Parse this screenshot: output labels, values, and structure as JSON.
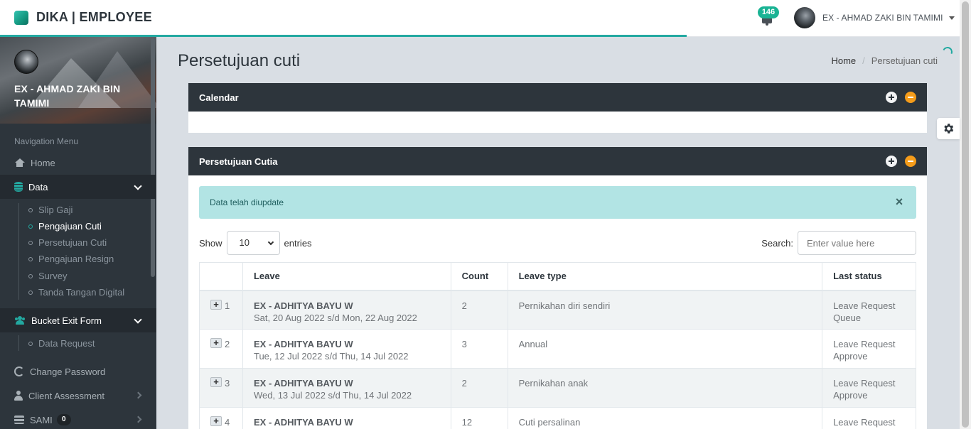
{
  "app": {
    "title": "DIKA | EMPLOYEE"
  },
  "header": {
    "notifications_count": "146",
    "user_name": "EX - AHMAD ZAKI BIN TAMIMI"
  },
  "sidebar": {
    "profile_name": "EX - AHMAD ZAKI BIN TAMIMI",
    "nav_header": "Navigation Menu",
    "home": "Home",
    "data": "Data",
    "data_items": [
      "Slip Gaji",
      "Pengajuan Cuti",
      "Persetujuan Cuti",
      "Pengajuan Resign",
      "Survey",
      "Tanda Tangan Digital"
    ],
    "bucket": "Bucket Exit Form",
    "bucket_items": [
      "Data Request"
    ],
    "change_password": "Change Password",
    "client_assessment": "Client Assessment",
    "sami": "SAMI",
    "sami_count": "0"
  },
  "page": {
    "title": "Persetujuan cuti",
    "breadcrumb_home": "Home",
    "breadcrumb_current": "Persetujuan cuti"
  },
  "calendar_panel": {
    "title": "Calendar"
  },
  "approval_panel": {
    "title": "Persetujuan Cutia",
    "alert": "Data telah diupdate",
    "alert_close": "×",
    "show_label": "Show",
    "entries_value": "10",
    "entries_label": "entries",
    "search_label": "Search:",
    "search_placeholder": "Enter value here"
  },
  "table": {
    "columns": [
      "",
      "Leave",
      "Count",
      "Leave type",
      "Last status"
    ],
    "rows": [
      {
        "no": "1",
        "name": "EX - ADHITYA BAYU W",
        "dates": "Sat, 20 Aug 2022 s/d Mon, 22 Aug 2022",
        "count": "2",
        "type": "Pernikahan diri sendiri",
        "status1": "Leave Request",
        "status2": "Queue"
      },
      {
        "no": "2",
        "name": "EX - ADHITYA BAYU W",
        "dates": "Tue, 12 Jul 2022 s/d Thu, 14 Jul 2022",
        "count": "3",
        "type": "Annual",
        "status1": "Leave Request",
        "status2": "Approve"
      },
      {
        "no": "3",
        "name": "EX - ADHITYA BAYU W",
        "dates": "Wed, 13 Jul 2022 s/d Thu, 14 Jul 2022",
        "count": "2",
        "type": "Pernikahan anak",
        "status1": "Leave Request",
        "status2": "Approve"
      },
      {
        "no": "4",
        "name": "EX - ADHITYA BAYU W",
        "dates": "",
        "count": "12",
        "type": "Cuti persalinan",
        "status1": "Leave Request",
        "status2": ""
      }
    ]
  },
  "colors": {
    "accent": "#23a9a1",
    "dark": "#2d353c",
    "warning": "#f59c1a"
  },
  "icons": [
    "notification-bell-icon",
    "home-icon",
    "database-icon",
    "users-icon",
    "refresh-icon",
    "user-icon",
    "stack-icon",
    "gear-icon",
    "expand-icon",
    "collapse-icon",
    "close-icon",
    "chevron-down-icon",
    "chevron-right-icon",
    "plus-icon"
  ]
}
